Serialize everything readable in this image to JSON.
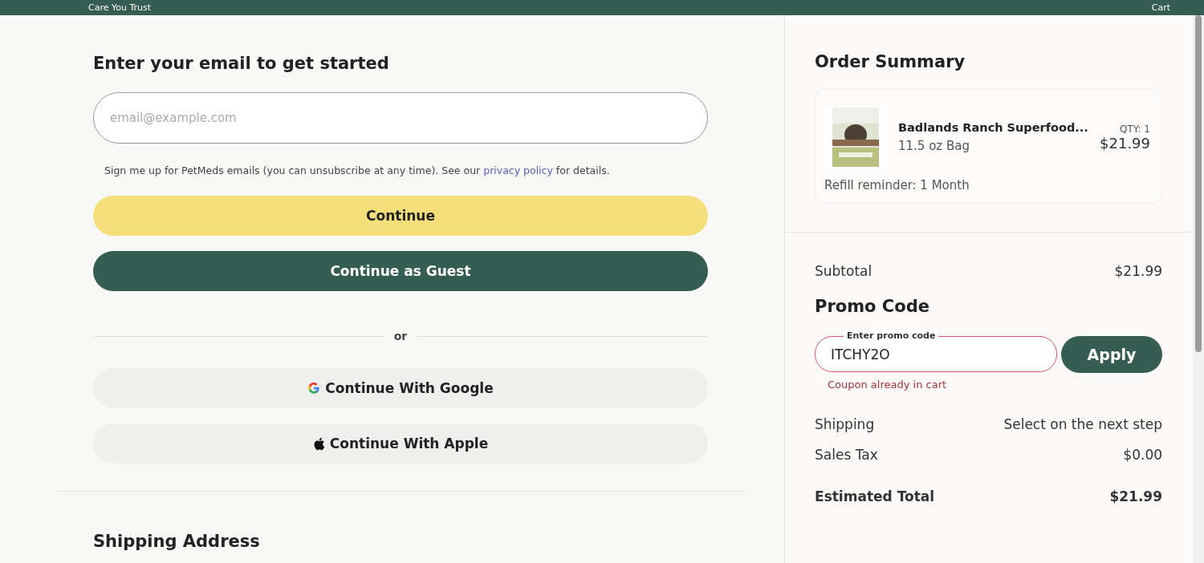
{
  "header": {
    "tagline": "Care You Trust",
    "cart": "Cart"
  },
  "email_section": {
    "title": "Enter your email to get started",
    "email_field": {
      "placeholder": "email@example.com"
    },
    "consent": "Sign me up for PetMeds emails (you can unsubscribe at any time). See our",
    "consent_link": "privacy policy",
    "consent_end": "for details.",
    "continue": "Continue",
    "guest": "Continue as Guest",
    "divider": "or",
    "social": [
      {
        "kind": "google",
        "label": "Continue With Google"
      },
      {
        "kind": "apple",
        "label": "Continue With Apple"
      }
    ]
  },
  "shipping_section": {
    "title": "Shipping Address"
  },
  "order_summary": {
    "title": "Order Summary",
    "items": [
      {
        "name": "Badlands Ranch Superfood...",
        "variant": "11.5 oz Bag",
        "qty": "QTY: 1",
        "price": "$21.99",
        "refill": "Refill reminder: 1 Month"
      }
    ],
    "subtotal": {
      "label": "Subtotal",
      "value": "$21.99"
    },
    "promo": {
      "title": "Promo Code",
      "field_label": "Enter promo code",
      "value": "ITCHY2O",
      "error": "Coupon already in cart",
      "button": "Apply"
    },
    "lines": [
      {
        "label": "Shipping",
        "value": "Select on the next step"
      },
      {
        "label": "Sales Tax",
        "value": "$0.00"
      }
    ],
    "total": {
      "label": "Estimated Total",
      "value": "$21.99"
    }
  }
}
